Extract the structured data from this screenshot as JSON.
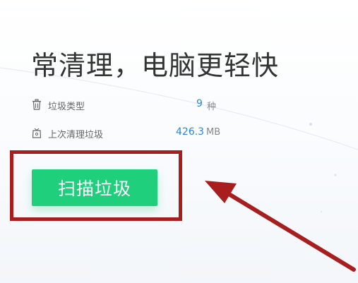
{
  "headline": "常清理，电脑更轻快",
  "stats": {
    "types": {
      "icon": "trash-can-icon",
      "label": "垃圾类型",
      "value": "9",
      "unit": "种"
    },
    "last_cleanup": {
      "icon": "trash-bag-icon",
      "label": "上次清理垃圾",
      "value": "426.3",
      "unit": "MB"
    }
  },
  "scan_button": {
    "label": "扫描垃圾"
  },
  "annotation": {
    "highlight_color": "#a81e1e",
    "arrow_color": "#a81e1e"
  },
  "colors": {
    "accent_green": "#1fcf7b",
    "value_blue": "#2f86d6",
    "headline_text": "#333333"
  }
}
